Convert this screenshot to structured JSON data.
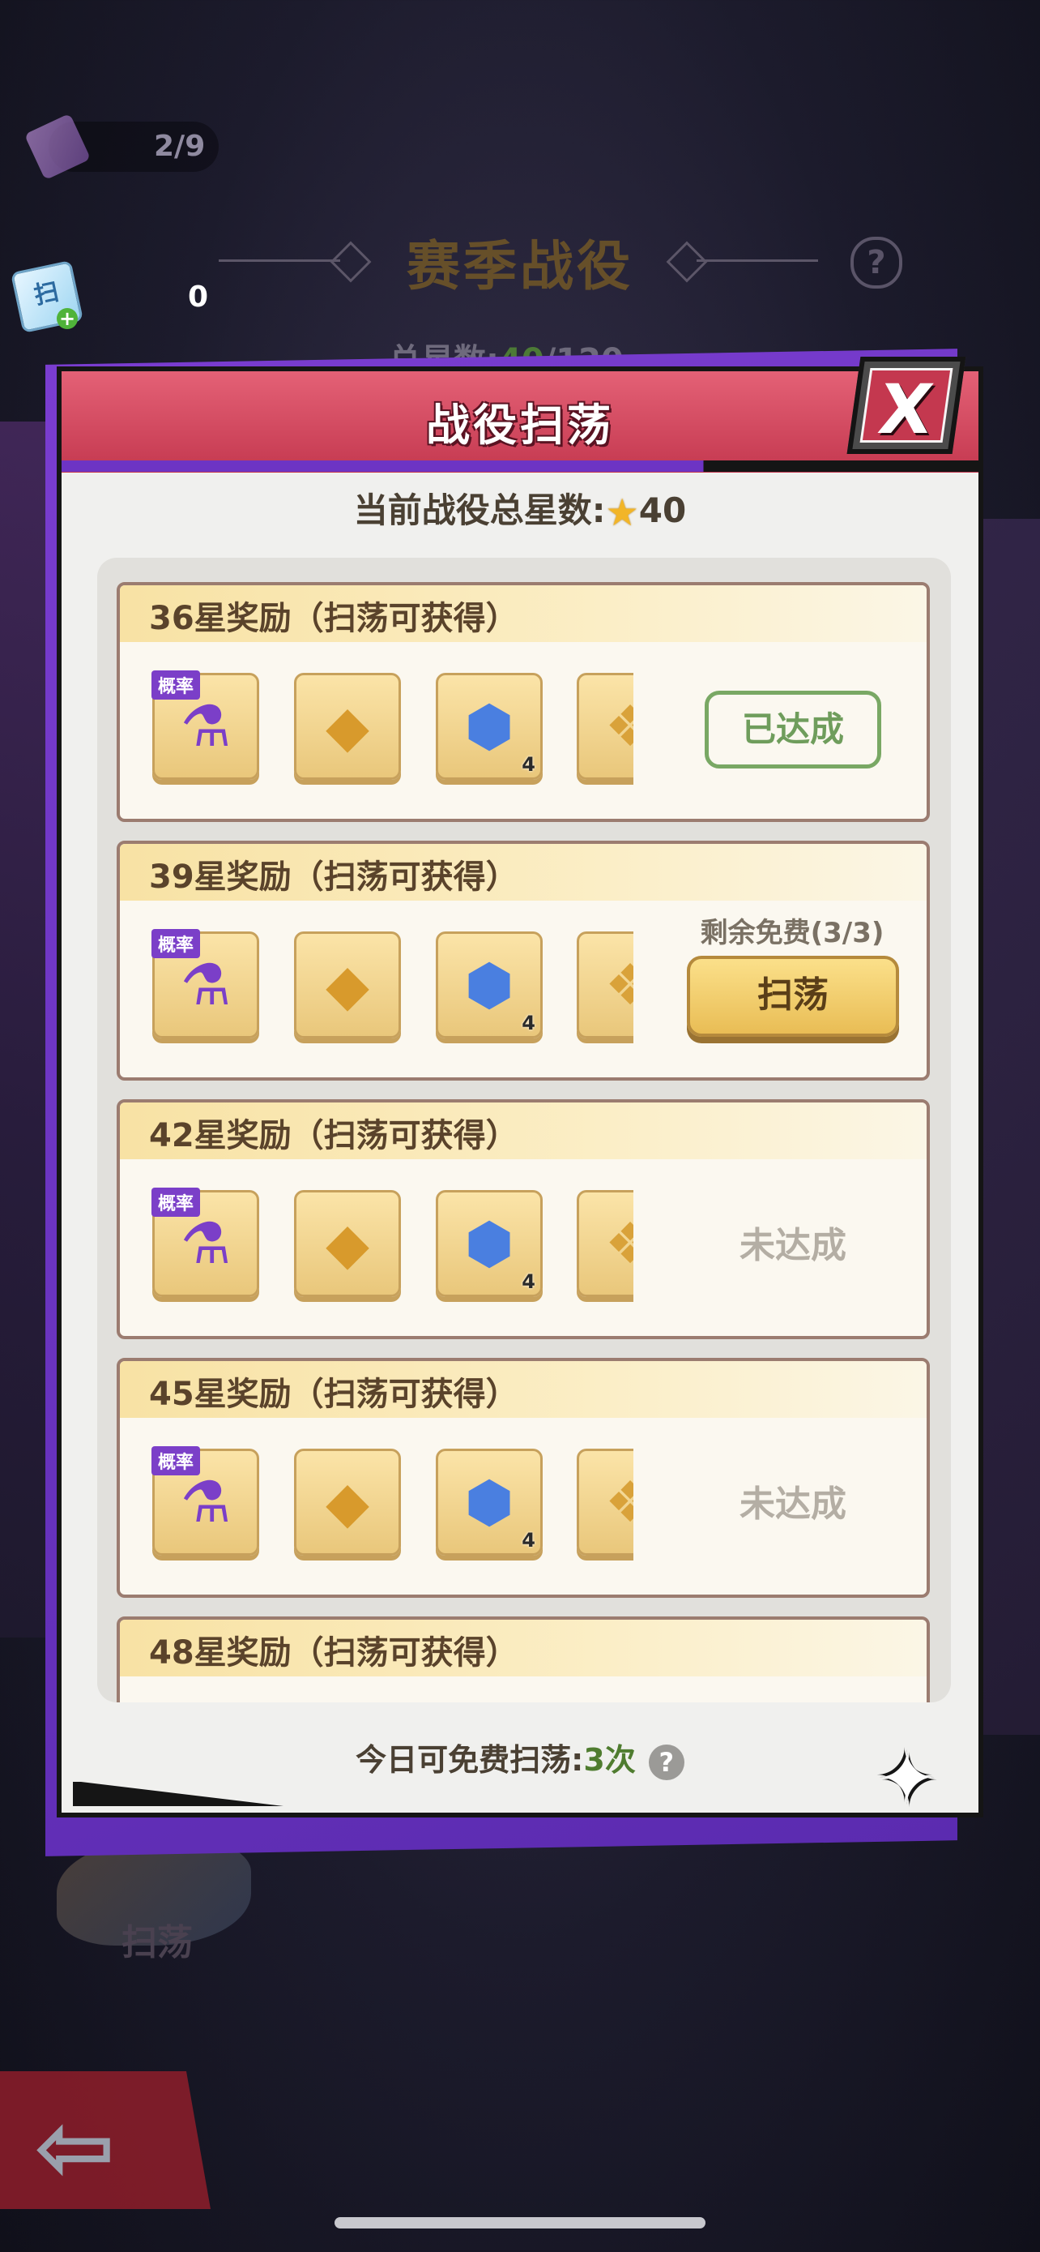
{
  "background": {
    "scan_progress": "2/9",
    "ticket_count": "0",
    "season_title": "赛季战役",
    "total_stars_label": "总星数:",
    "total_stars_value": "40",
    "total_stars_max": "/120",
    "ship_label": "扫荡"
  },
  "dialog": {
    "title": "战役扫荡",
    "close_label": "X",
    "current_stars_label": "当前战役总星数:",
    "current_stars_value": "40",
    "free_today_label": "今日可免费扫荡:",
    "free_today_count": "3次",
    "help_label": "?"
  },
  "rewards": [
    {
      "title": "36星奖励（扫荡可获得）",
      "status": "done",
      "status_text": "已达成",
      "items": [
        {
          "icon": "energy-potion-icon",
          "tag": "概率",
          "qty": ""
        },
        {
          "icon": "gold-ore-icon",
          "tag": "",
          "qty": ""
        },
        {
          "icon": "blue-cube-icon",
          "tag": "",
          "qty": "4"
        },
        {
          "icon": "winged-emblem-icon",
          "tag": "",
          "qty": ""
        }
      ]
    },
    {
      "title": "39星奖励（扫荡可获得）",
      "status": "available",
      "free_remaining": "剩余免费(3/3)",
      "button_label": "扫荡",
      "items": [
        {
          "icon": "energy-potion-icon",
          "tag": "概率",
          "qty": ""
        },
        {
          "icon": "gold-ore-icon",
          "tag": "",
          "qty": ""
        },
        {
          "icon": "blue-cube-icon",
          "tag": "",
          "qty": "4"
        },
        {
          "icon": "winged-emblem-icon",
          "tag": "",
          "qty": ""
        }
      ]
    },
    {
      "title": "42星奖励（扫荡可获得）",
      "status": "locked",
      "status_text": "未达成",
      "items": [
        {
          "icon": "energy-potion-icon",
          "tag": "概率",
          "qty": ""
        },
        {
          "icon": "gold-ore-icon",
          "tag": "",
          "qty": ""
        },
        {
          "icon": "blue-cube-icon",
          "tag": "",
          "qty": "4"
        },
        {
          "icon": "winged-emblem-icon",
          "tag": "",
          "qty": ""
        }
      ]
    },
    {
      "title": "45星奖励（扫荡可获得）",
      "status": "locked",
      "status_text": "未达成",
      "items": [
        {
          "icon": "energy-potion-icon",
          "tag": "概率",
          "qty": ""
        },
        {
          "icon": "gold-ore-icon",
          "tag": "",
          "qty": ""
        },
        {
          "icon": "blue-cube-icon",
          "tag": "",
          "qty": "4"
        },
        {
          "icon": "winged-emblem-icon",
          "tag": "",
          "qty": ""
        }
      ]
    },
    {
      "title": "48星奖励（扫荡可获得）"
    }
  ],
  "colors": {
    "header_red": "#c4384f",
    "accent_purple": "#6d34c4",
    "done_green": "#79a864",
    "gold_button": "#e9bd55"
  }
}
